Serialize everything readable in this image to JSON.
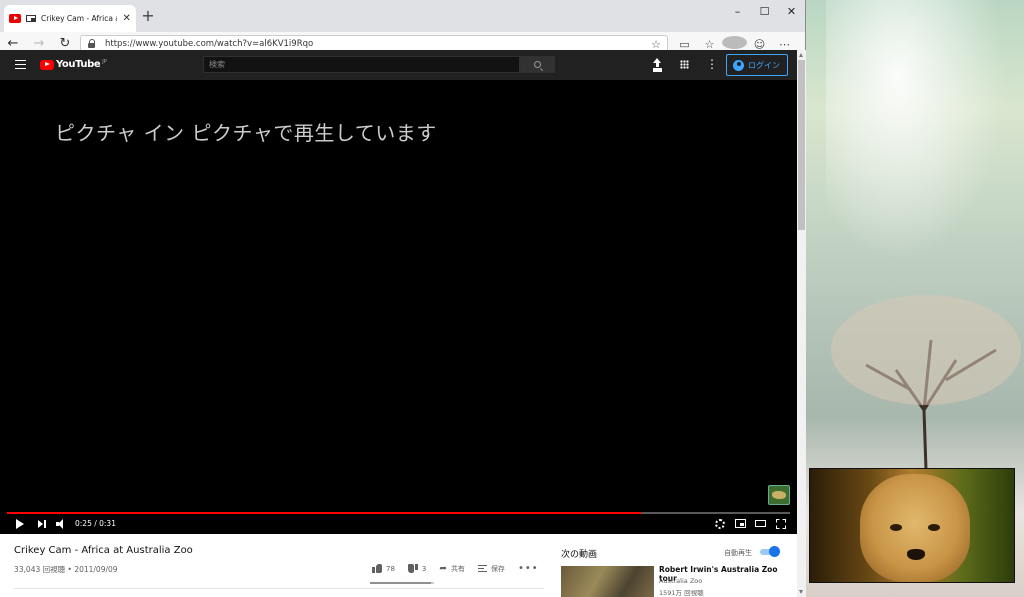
{
  "browser": {
    "tab_title": "Crikey Cam - Africa at Austra",
    "tab_close": "✕",
    "new_tab": "+",
    "window_controls": {
      "minimize": "–",
      "maximize": "☐",
      "close": "✕"
    },
    "nav": {
      "back": "←",
      "forward": "→",
      "refresh": "↻"
    },
    "url": "https://www.youtube.com/watch?v=al6KV1i9Rqo",
    "star": "☆",
    "toolbar_icons": [
      "reading-view-icon",
      "favorites-icon",
      "profile-icon",
      "emoji-icon",
      "more-icon"
    ],
    "toolbar_glyphs": {
      "favorites": "☆",
      "emoji": "☺",
      "more": "⋯"
    }
  },
  "youtube": {
    "logo_text": "YouTube",
    "logo_region": "JP",
    "search_placeholder": "検索",
    "more_glyph": "⋮",
    "login_label": "ログイン",
    "pip_message": "ピクチャ イン ピクチャで再生しています",
    "player": {
      "current_time": "0:25",
      "duration": "0:31",
      "time_display": "0:25 / 0:31",
      "progress": 0.81
    },
    "video": {
      "title": "Crikey Cam - Africa at Australia Zoo",
      "meta": "33,043 回視聴 • 2011/09/09",
      "likes": "78",
      "dislikes": "3",
      "like_ratio": 0.96,
      "share_label": "共有",
      "save_label": "保存",
      "more_label": "•••"
    },
    "sidebar": {
      "up_next": "次の動画",
      "autoplay_label": "自動再生",
      "autoplay_on": true,
      "recommendations": [
        {
          "title": "Robert Irwin's Australia Zoo tour",
          "channel": "Australia Zoo",
          "views": "1591万 回視聴"
        }
      ]
    }
  },
  "colors": {
    "yt_dark": "#212121",
    "yt_red": "#ff0000",
    "link_blue": "#3ea6ff",
    "toggle_blue": "#1a73e8"
  }
}
